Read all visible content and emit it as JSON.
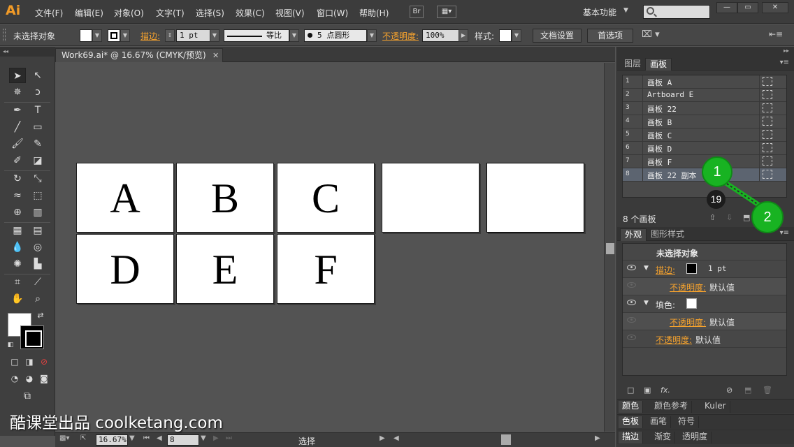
{
  "app": {
    "logo": "Ai"
  },
  "menu": [
    {
      "label": "文件(F)"
    },
    {
      "label": "编辑(E)"
    },
    {
      "label": "对象(O)"
    },
    {
      "label": "文字(T)"
    },
    {
      "label": "选择(S)"
    },
    {
      "label": "效果(C)"
    },
    {
      "label": "视图(V)"
    },
    {
      "label": "窗口(W)"
    },
    {
      "label": "帮助(H)"
    }
  ],
  "bridge_btn": "Br",
  "workspace": "基本功能",
  "control": {
    "selection": "未选择对象",
    "stroke_label": "描边:",
    "stroke_weight": "1 pt",
    "profile": "等比",
    "brush": "5 点圆形",
    "opacity_label": "不透明度:",
    "opacity_value": "100%",
    "style_label": "样式:",
    "doc_setup": "文档设置",
    "preferences": "首选项"
  },
  "document": {
    "tab_title": "Work69.ai* @ 16.67% (CMYK/预览)",
    "artboards": [
      {
        "letter": "A"
      },
      {
        "letter": "B"
      },
      {
        "letter": "C"
      },
      {
        "letter": ""
      },
      {
        "letter": ""
      },
      {
        "letter": "D"
      },
      {
        "letter": "E"
      },
      {
        "letter": "F"
      }
    ]
  },
  "status": {
    "zoom": "16.67%",
    "artboard_num": "8",
    "tool": "选择"
  },
  "panels": {
    "top_tabs": [
      "图层",
      "画板"
    ],
    "artboards": [
      {
        "num": "1",
        "name": "画板 A"
      },
      {
        "num": "2",
        "name": "Artboard E"
      },
      {
        "num": "3",
        "name": "画板 22"
      },
      {
        "num": "4",
        "name": "画板 B"
      },
      {
        "num": "5",
        "name": "画板 C"
      },
      {
        "num": "6",
        "name": "画板 D"
      },
      {
        "num": "7",
        "name": "画板 F"
      },
      {
        "num": "8",
        "name": "画板 22 副本"
      }
    ],
    "artboard_count": "8 个画板",
    "appearance_tabs": [
      "外观",
      "图形样式"
    ],
    "appearance": {
      "title": "未选择对象",
      "stroke_label": "描边:",
      "stroke_value": "1 pt",
      "opacity_label": "不透明度:",
      "default_value": "默认值",
      "fill_label": "填色:"
    },
    "collapsed_1": [
      "颜色",
      "颜色参考",
      "Kuler"
    ],
    "collapsed_2": [
      "色板",
      "画笔",
      "符号"
    ],
    "collapsed_3": [
      "描边",
      "渐变",
      "透明度"
    ]
  },
  "overlay": {
    "callout_1": "1",
    "callout_2": "2",
    "step": "19",
    "watermark": "酷课堂出品 coolketang.com",
    "accent": "#18b322"
  }
}
